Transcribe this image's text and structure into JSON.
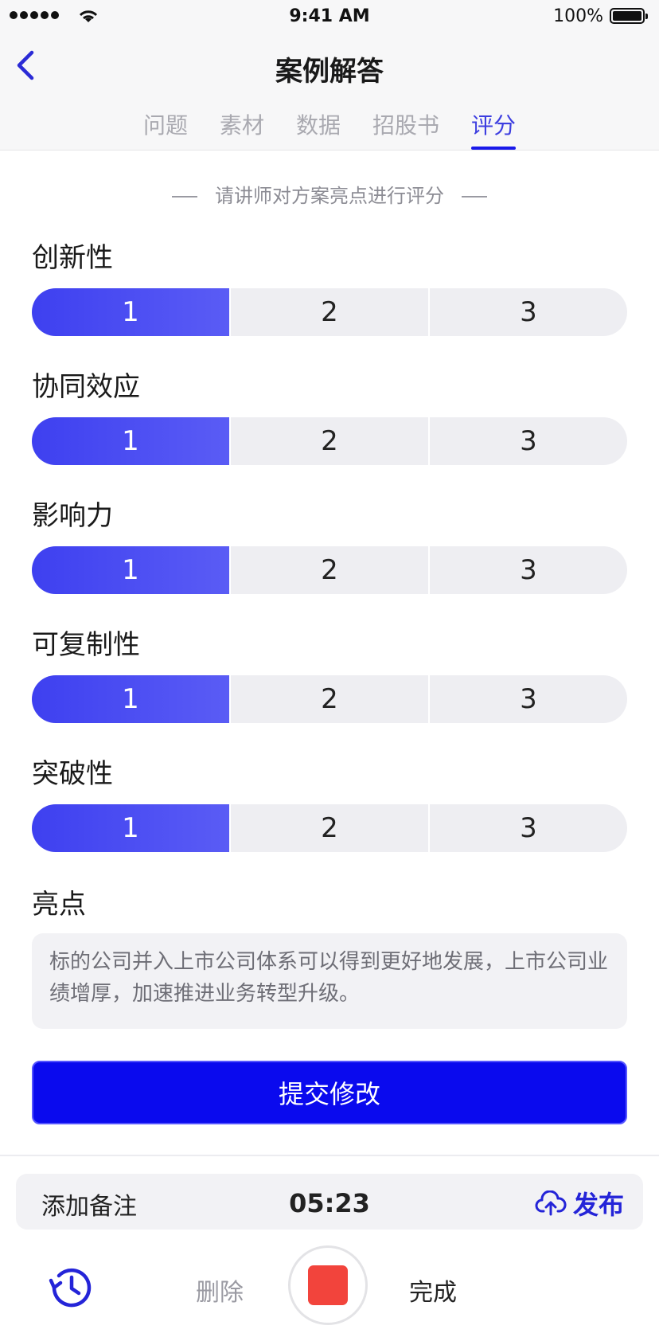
{
  "status_bar": {
    "time": "9:41 AM",
    "battery": "100%"
  },
  "header": {
    "title": "案例解答"
  },
  "tabs": [
    {
      "label": "问题",
      "active": false
    },
    {
      "label": "素材",
      "active": false
    },
    {
      "label": "数据",
      "active": false
    },
    {
      "label": "招股书",
      "active": false
    },
    {
      "label": "评分",
      "active": true
    }
  ],
  "hint": "请讲师对方案亮点进行评分",
  "criteria": [
    {
      "label": "创新性",
      "options": [
        "1",
        "2",
        "3"
      ],
      "selected": "1"
    },
    {
      "label": "协同效应",
      "options": [
        "1",
        "2",
        "3"
      ],
      "selected": "1"
    },
    {
      "label": "影响力",
      "options": [
        "1",
        "2",
        "3"
      ],
      "selected": "1"
    },
    {
      "label": "可复制性",
      "options": [
        "1",
        "2",
        "3"
      ],
      "selected": "1"
    },
    {
      "label": "突破性",
      "options": [
        "1",
        "2",
        "3"
      ],
      "selected": "1"
    }
  ],
  "highlight": {
    "label": "亮点",
    "text": "标的公司并入上市公司体系可以得到更好地发展，上市公司业绩增厚，加速推进业务转型升级。"
  },
  "submit_label": "提交修改",
  "recorder": {
    "add_note": "添加备注",
    "timer": "05:23",
    "publish": "发布",
    "delete": "删除",
    "done": "完成"
  },
  "colors": {
    "accent": "#3e40f0",
    "submit": "#0a0aee",
    "record": "#f2443c"
  },
  "icons": {
    "back": "chevron-left-icon",
    "publish": "cloud-upload-icon",
    "history": "history-icon"
  }
}
